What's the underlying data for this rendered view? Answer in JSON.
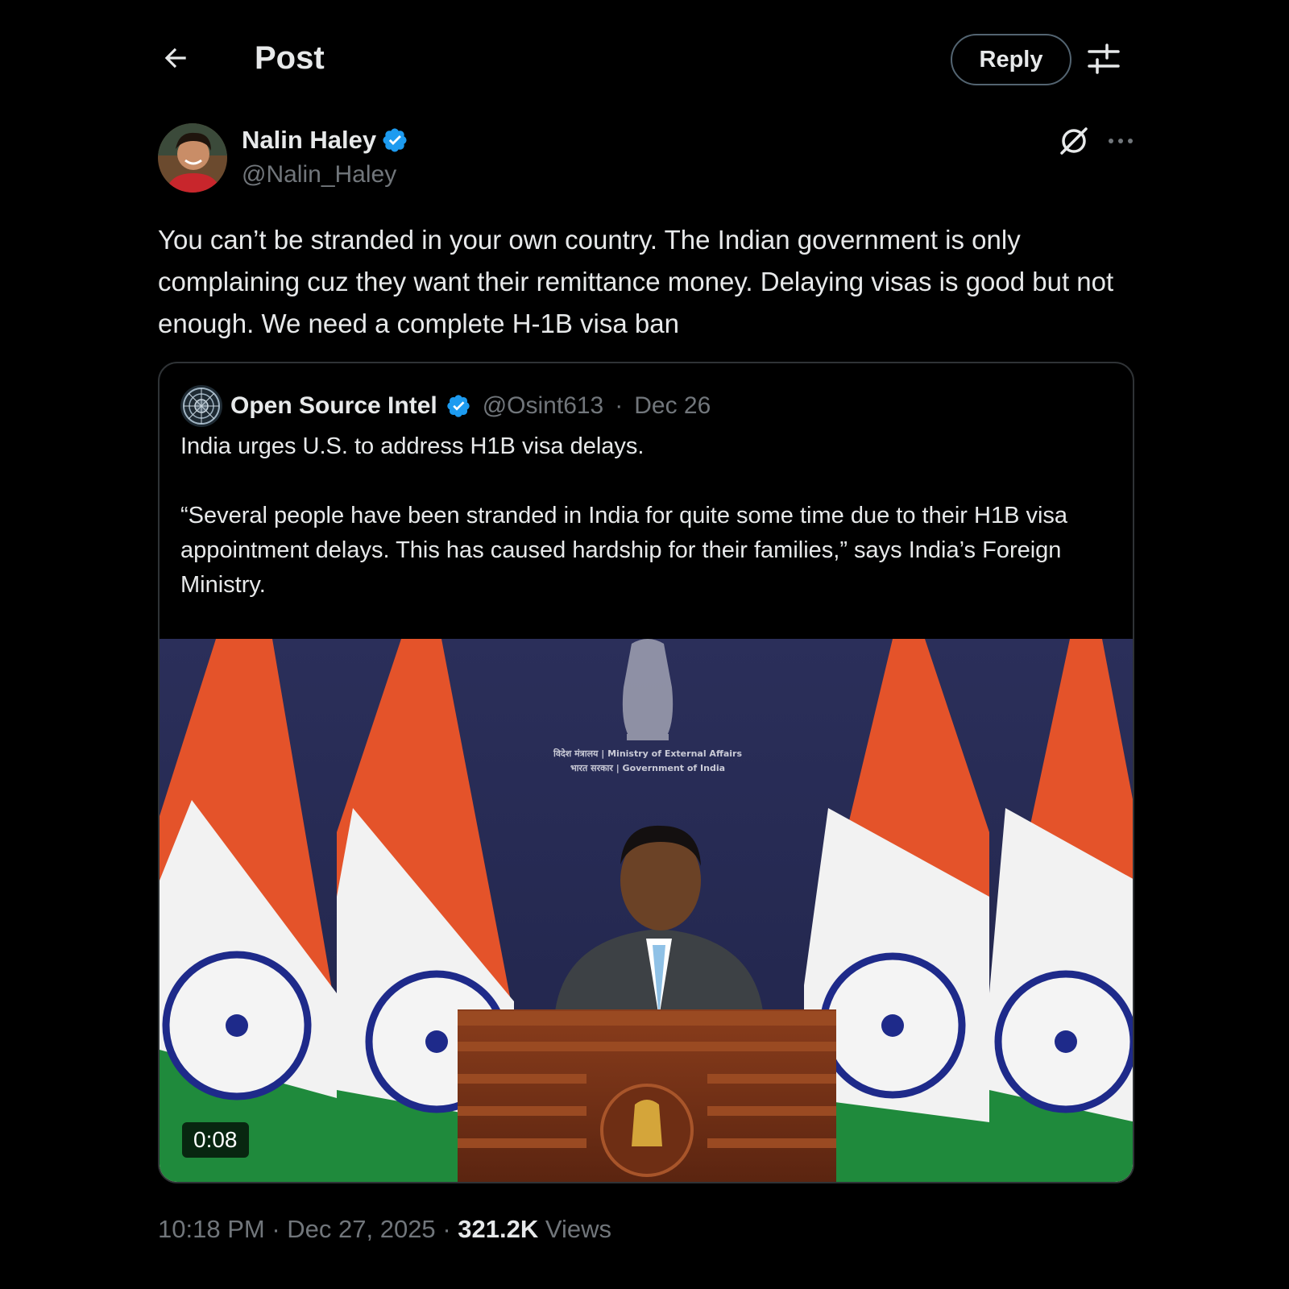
{
  "header": {
    "title": "Post",
    "reply_label": "Reply"
  },
  "author": {
    "name": "Nalin Haley",
    "handle": "@Nalin_Haley",
    "verified": true
  },
  "post": {
    "text": "You can’t be stranded in your own country. The Indian government is only complaining cuz they want their remittance money. Delaying visas is good but not enough. We need a complete H-1B visa ban",
    "time": "10:18 PM",
    "date": "Dec 27, 2025",
    "views_count": "321.2K",
    "views_label": "Views"
  },
  "quote": {
    "name": "Open Source Intel",
    "handle": "@Osint613",
    "date": "Dec 26",
    "text_line1": "India urges U.S. to address H1B visa delays.",
    "text_line2": "“Several people have been stranded in India for quite some time due to their H1B visa appointment delays. This has caused hardship for their families,” says India’s Foreign Ministry.",
    "video_duration": "0:08",
    "video_backdrop_text_1": "विदेश मंत्रालय | Ministry of External Affairs",
    "video_backdrop_text_2": "भारत सरकार | Government of India"
  },
  "icons": {
    "back": "arrow-left-icon",
    "settings": "sliders-icon",
    "verified": "verified-badge-icon",
    "grok": "grok-icon",
    "more": "more-dots-icon"
  },
  "colors": {
    "background": "#000000",
    "text": "#e7e9ea",
    "secondary_text": "#71767b",
    "border": "#2f3336",
    "verified_blue": "#1d9bf0"
  }
}
